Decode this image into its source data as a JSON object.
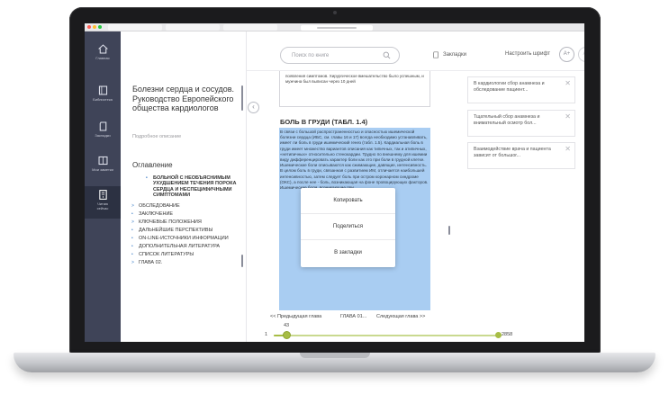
{
  "sidebar": {
    "items": [
      {
        "label": "Главная",
        "icon": "home-icon"
      },
      {
        "label": "Библиотека",
        "icon": "library-icon"
      },
      {
        "label": "Закладки",
        "icon": "bookmarks-icon"
      },
      {
        "label": "Мои заметки",
        "icon": "notes-icon"
      },
      {
        "label": "Читаю\nсейчас",
        "icon": "current-book-icon",
        "active": true
      }
    ]
  },
  "book": {
    "title": "Болезни сердца и сосудов. Руководство Европейского общества кардиологов",
    "description_link": "Подробное описание"
  },
  "toc": {
    "heading": "Оглавление",
    "items": [
      {
        "label": "БОЛЬНОЙ С НЕОБЪЯСНИМЫМ УХУДШЕНИЕМ ТЕЧЕНИЯ ПОРОКА СЕРДЦА И НЕСПЕЦИФИЧНЫМИ СИМПТОМАМИ",
        "marker": "•",
        "sub": true
      },
      {
        "label": "ОБСЛЕДОВАНИЕ",
        "marker": ">"
      },
      {
        "label": "ЗАКЛЮЧЕНИЕ",
        "marker": "•"
      },
      {
        "label": "КЛЮЧЕВЫЕ ПОЛОЖЕНИЯ",
        "marker": ">"
      },
      {
        "label": "ДАЛЬНЕЙШИЕ ПЕРСПЕКТИВЫ",
        "marker": "•"
      },
      {
        "label": "ON-LINE-ИСТОЧНИКИ ИНФОРМАЦИИ",
        "marker": "•"
      },
      {
        "label": "ДОПОЛНИТЕЛЬНАЯ ЛИТЕРАТУРА",
        "marker": "•"
      },
      {
        "label": "СПИСОК ЛИТЕРАТУРЫ",
        "marker": "•"
      },
      {
        "label": "ГЛАВА 02.",
        "marker": ">"
      }
    ]
  },
  "header": {
    "search_placeholder": "Поиск по книге",
    "bookmarks_label": "Закладки",
    "font_label": "Настроить шрифт",
    "font_increase": "А+",
    "font_decrease": "А-"
  },
  "reader": {
    "previous_text": "появления симптомов. Хирургическое вмешательство было успешным, и мужчина был выписан через 10 дней",
    "section_title": "БОЛЬ В ГРУДИ (ТАБЛ. 1.4)",
    "highlighted_text": "В связи с большой распространенностью и опасностью ишемической болезни сердца (ИБС, см. главы 16 и 17) всегда необходимо устанавливать, имеет ли боль в груди ишемический генез (табл. 1.5). Кардиальная боль в груди имеет множество вариантов описания как типичных, так и атипичных, «нетипичных» относительно стенокардии. Трудно по внешнему для ишемии виду дифференцировать характер боли как это при боли в грудной клетке. Ишемические боли описываются как сжимающие, давящие, интенсивность. В целом боль в груди, связанная с развитием ИМ, отличается наибольшей интенсивностью, затем следует боль при остром коронарном синдроме (ОКС), а после нее - боль, возникающая на фоне провоцирующих факторов. Ишемические боли, возникающие при"
  },
  "context_menu": {
    "items": [
      "Копировать",
      "Поделиться",
      "В закладки"
    ]
  },
  "chapter_nav": {
    "prev": "<< Предыдущая глава",
    "current": "ГЛАВА 01...",
    "next": "Следующая глава >>"
  },
  "progress": {
    "start": "1",
    "current": "43",
    "end": "2858",
    "current_page": 43,
    "total_pages": 2858
  },
  "notes": {
    "items": [
      "В кардиологии сбор анамнеза и обследование пациент...",
      "Тщательный сбор анамнеза и внимательный осмотр бол...",
      "Взаимодействие врача и пациента зависит от большог..."
    ],
    "close_glyph": "✕"
  },
  "colors": {
    "rail": "#3f4458",
    "highlight": "#a9cdf2",
    "accent_green": "#a7bd45",
    "link_blue": "#3f7fc8"
  }
}
